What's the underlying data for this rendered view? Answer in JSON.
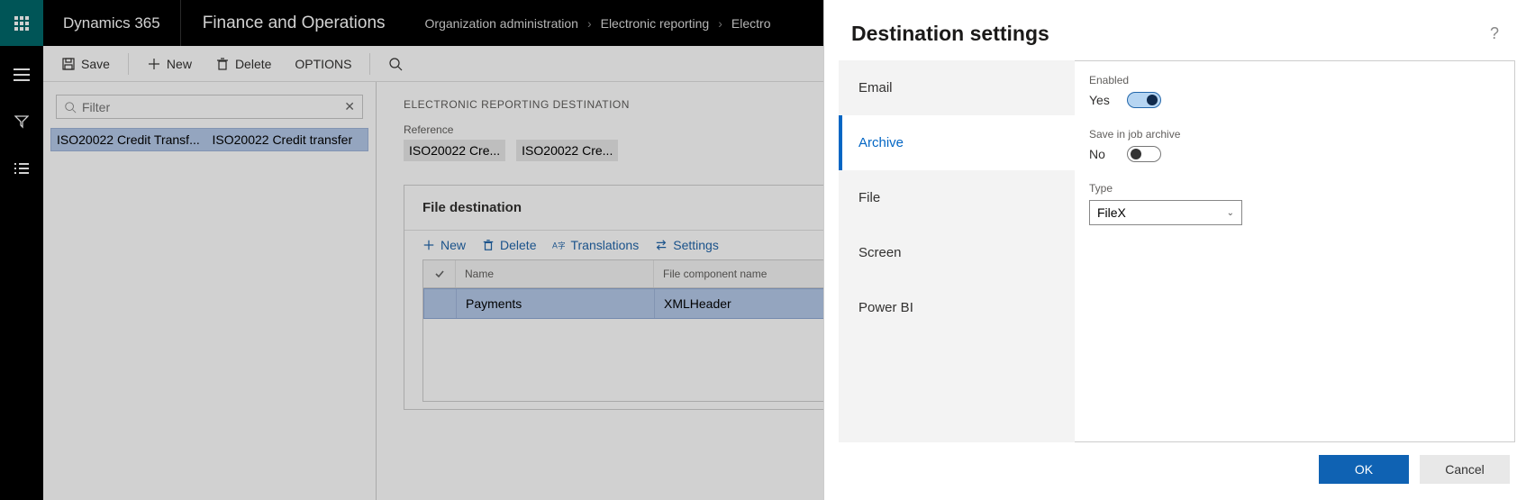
{
  "nav": {
    "brand": "Dynamics 365",
    "module": "Finance and Operations",
    "crumbs": [
      "Organization administration",
      "Electronic reporting",
      "Electronic reporting destination"
    ]
  },
  "actions": {
    "save": "Save",
    "new": "New",
    "delete": "Delete",
    "options": "OPTIONS"
  },
  "leftpanel": {
    "filter_placeholder": "Filter",
    "row": {
      "ref_short": "ISO20022 Credit Transf...",
      "name": "ISO20022 Credit transfer"
    }
  },
  "rightpanel": {
    "section_title": "ELECTRONIC REPORTING DESTINATION",
    "reference_label": "Reference",
    "ref1": "ISO20022 Cre...",
    "ref2": "ISO20022 Cre...",
    "card_title": "File destination",
    "tb_new": "New",
    "tb_delete": "Delete",
    "tb_translations": "Translations",
    "tb_settings": "Settings",
    "grid": {
      "col_name": "Name",
      "col_comp": "File component name",
      "row_name": "Payments",
      "row_comp": "XMLHeader"
    }
  },
  "dialog": {
    "title": "Destination settings",
    "tabs": [
      "Email",
      "Archive",
      "File",
      "Screen",
      "Power BI"
    ],
    "active_tab": "Archive",
    "enabled_label": "Enabled",
    "enabled_value": "Yes",
    "savejob_label": "Save in job archive",
    "savejob_value": "No",
    "type_label": "Type",
    "type_value": "FileX",
    "ok": "OK",
    "cancel": "Cancel"
  }
}
